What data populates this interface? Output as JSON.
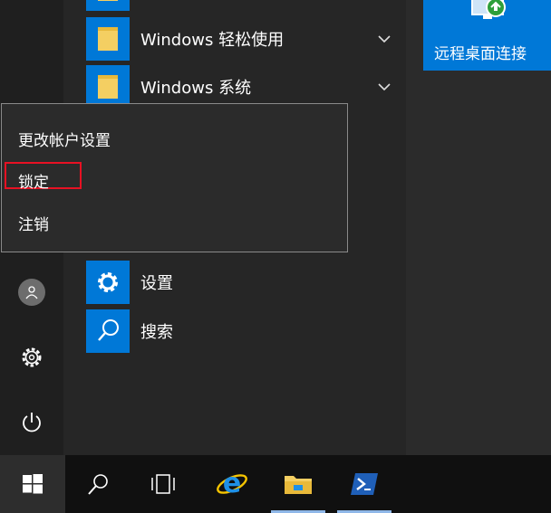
{
  "app_list": {
    "items": [
      {
        "label": "Windows 轻松使用",
        "icon": "folder-icon",
        "expandable": true
      },
      {
        "label": "Windows 系统",
        "icon": "folder-icon",
        "expandable": true
      }
    ],
    "bottom_items": [
      {
        "label": "设置",
        "icon": "gear-icon"
      },
      {
        "label": "搜索",
        "icon": "search-icon"
      }
    ]
  },
  "tiles": [
    {
      "label": "远程桌面连接",
      "icon": "remote-desktop-icon"
    }
  ],
  "user_menu": {
    "items": [
      {
        "label": "更改帐户设置"
      },
      {
        "label": "锁定",
        "highlighted": true
      },
      {
        "label": "注销"
      }
    ]
  },
  "rail": {
    "items": [
      "user-avatar-icon",
      "settings-gear-icon",
      "power-icon"
    ]
  },
  "taskbar": {
    "items": [
      "windows-start-icon",
      "search-icon",
      "task-view-icon",
      "internet-explorer-icon",
      "file-explorer-icon",
      "powershell-icon"
    ]
  },
  "colors": {
    "accent": "#0078d7",
    "highlight_border": "#e81123",
    "folder": "#f4cf62"
  }
}
